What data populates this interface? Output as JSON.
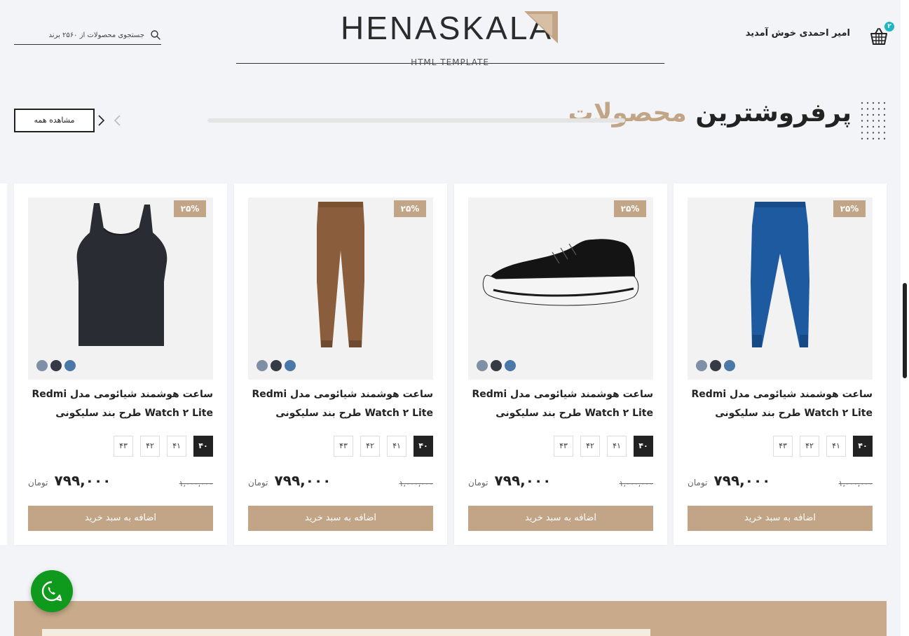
{
  "header": {
    "cart_count": "۲",
    "welcome": "امیر احمدی خوش آمدید",
    "logo_text": "HENASKALA",
    "logo_sub": "HTML TEMPLATE",
    "search_placeholder": "جستجوی محصولات از ۲۵۶۰ برند"
  },
  "section": {
    "title_part1": "پرفروشترین",
    "title_part2": "محصولات",
    "view_all": "مشاهده همه"
  },
  "colors": {
    "accent": "#c2a586",
    "dark": "#222222",
    "teal_badge": "#1fb6c1",
    "whatsapp": "#0f9a1e"
  },
  "products": [
    {
      "image": "blue-pants",
      "badge": "۲۵%",
      "title": "ساعت هوشمند شیائومی مدل Redmi Watch ۲ Lite طرح بند سلیکونی",
      "sizes": [
        "۴۰",
        "۴۱",
        "۴۲",
        "۴۳"
      ],
      "old_price": "۱,۰۰۰,۰۰۰",
      "price": "۷۹۹,۰۰۰",
      "currency": "تومان",
      "button": "اضافه به سبد خرید"
    },
    {
      "image": "black-sneaker",
      "badge": "۲۵%",
      "title": "ساعت هوشمند شیائومی مدل Redmi Watch ۲ Lite طرح بند سلیکونی",
      "sizes": [
        "۴۰",
        "۴۱",
        "۴۲",
        "۴۳"
      ],
      "old_price": "۱,۰۰۰,۰۰۰",
      "price": "۷۹۹,۰۰۰",
      "currency": "تومان",
      "button": "اضافه به سبد خرید"
    },
    {
      "image": "brown-pants",
      "badge": "۲۵%",
      "title": "ساعت هوشمند شیائومی مدل Redmi Watch ۲ Lite طرح بند سلیکونی",
      "sizes": [
        "۴۰",
        "۴۱",
        "۴۲",
        "۴۳"
      ],
      "old_price": "۱,۰۰۰,۰۰۰",
      "price": "۷۹۹,۰۰۰",
      "currency": "تومان",
      "button": "اضافه به سبد خرید"
    },
    {
      "image": "black-tank-top",
      "badge": "۲۵%",
      "title": "ساعت هوشمند شیائومی مدل Redmi Watch ۲ Lite طرح بند سلیکونی",
      "sizes": [
        "۴۰",
        "۴۱",
        "۴۲",
        "۴۳"
      ],
      "old_price": "۱,۰۰۰,۰۰۰",
      "price": "۷۹۹,۰۰۰",
      "currency": "تومان",
      "button": "اضافه به سبد خرید"
    }
  ],
  "swatch_colors": [
    "#4a78a8",
    "#353a45",
    "#7f8fa6"
  ]
}
